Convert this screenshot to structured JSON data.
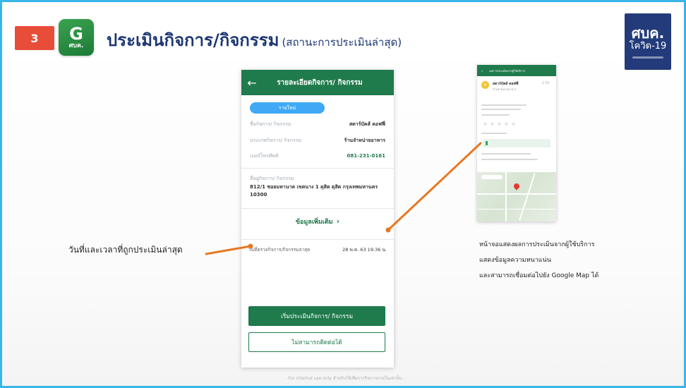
{
  "slide": {
    "step_number": "3",
    "app_logo": {
      "glyph": "G",
      "text": "ศบค."
    },
    "title": "ประเมินกิจการ/กิจกรรม",
    "subtitle": "(สถานะการประเมินล่าสุด)",
    "brand_logo": {
      "line1": "ศบค.",
      "line2": "โควิด-19"
    },
    "footer_note": "- For internal use only สำหรับใช้เพื่อการกิจการภายในเท่านั้น -"
  },
  "phone": {
    "header_title": "รายละเอียดกิจการ/ กิจกรรม",
    "back_icon": "arrow-left-icon",
    "status_badge": "รายใหม่",
    "fields": [
      {
        "label": "ชื่อกิจการ/ กิจกรรม",
        "value": "สตาร์บัคส์ คอฟฟี่"
      },
      {
        "label": "ประเภทกิจการ/ กิจกรรม",
        "value": "ร้านจำหน่ายอาหาร"
      },
      {
        "label": "เบอร์โทรศัพท์",
        "value": "081-231-0161"
      }
    ],
    "address_label": "ที่อยู่กิจการ/ กิจกรรม",
    "address_value": "812/1 ซอยมหานาค เขตนาง 1 ดุสิต ดุสิต กรุงเทพมหานคร 10300",
    "more_link": "ข้อมูลเพิ่มเติม",
    "last_eval_label": "วันที่ตรวจกิจการ/กิจกรรมล่าสุด",
    "last_eval_value": "28 พ.ค. 63 19:36 น.",
    "primary_button": "เริ่มประเมินกิจการ/ กิจกรรม",
    "secondary_button": "ไม่สามารถติดต่อได้"
  },
  "phone2": {
    "header_title": "ผลการประเมินจากผู้ใช้บริการ",
    "place_name": "สตาร์บัคส์ คอฟฟี่",
    "place_sub": "ร้านจำหน่ายอาหาร",
    "rating": "4.7/5"
  },
  "annotations": {
    "left": "วันที่และเวลาที่ถูกประเมินล่าสุด",
    "right": [
      "หน้าจอแสดงผลการประเมินจากผู้ใช้บริการ",
      "แสดงข้อมูลความหนาแน่น",
      "และสามารถเชื่อมต่อไปยัง Google Map ได้"
    ]
  },
  "colors": {
    "frame": "#38b6e8",
    "step_badge": "#e84d3a",
    "title": "#1e3773",
    "app_green": "#1f7a4c",
    "connector": "#e87722"
  }
}
